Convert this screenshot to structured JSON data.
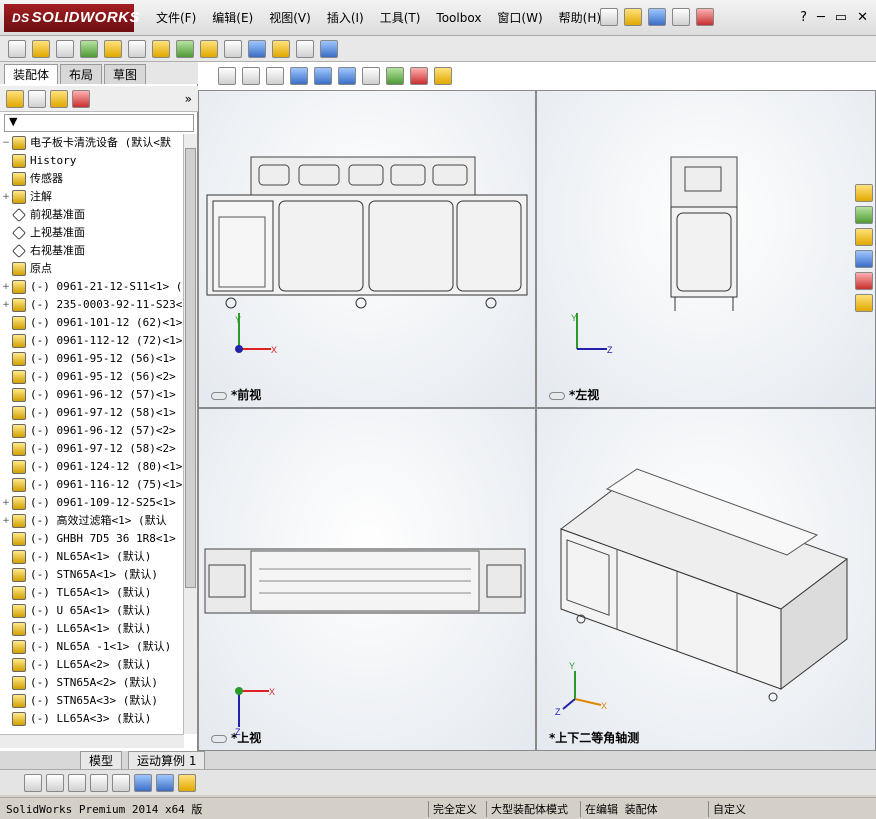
{
  "app": {
    "title": "SOLIDWORKS",
    "logo_prefix": "DS"
  },
  "menu": [
    "文件(F)",
    "编辑(E)",
    "视图(V)",
    "插入(I)",
    "工具(T)",
    "Toolbox",
    "窗口(W)",
    "帮助(H)"
  ],
  "panel": {
    "tabs": [
      "装配体",
      "布局",
      "草图"
    ],
    "root": "电子板卡清洗设备 (默认<默",
    "tree": [
      {
        "label": "History",
        "icon": "history-icon",
        "exp": ""
      },
      {
        "label": "传感器",
        "icon": "sensor-icon",
        "exp": ""
      },
      {
        "label": "注解",
        "icon": "annotation-icon",
        "exp": "+"
      },
      {
        "label": "前视基准面",
        "icon": "plane-icon",
        "exp": ""
      },
      {
        "label": "上视基准面",
        "icon": "plane-icon",
        "exp": ""
      },
      {
        "label": "右视基准面",
        "icon": "plane-icon",
        "exp": ""
      },
      {
        "label": "原点",
        "icon": "origin-icon",
        "exp": ""
      },
      {
        "label": "(-) 0961-21-12-S11<1> (",
        "icon": "part-icon",
        "exp": "+"
      },
      {
        "label": "(-) 235-0003-92-11-S23<",
        "icon": "part-icon",
        "exp": "+"
      },
      {
        "label": "(-) 0961-101-12 (62)<1>",
        "icon": "part-icon",
        "exp": ""
      },
      {
        "label": "(-) 0961-112-12 (72)<1>",
        "icon": "part-icon",
        "exp": ""
      },
      {
        "label": "(-) 0961-95-12 (56)<1>",
        "icon": "part-icon",
        "exp": ""
      },
      {
        "label": "(-) 0961-95-12 (56)<2>",
        "icon": "part-icon",
        "exp": ""
      },
      {
        "label": "(-) 0961-96-12 (57)<1>",
        "icon": "part-icon",
        "exp": ""
      },
      {
        "label": "(-) 0961-97-12 (58)<1>",
        "icon": "part-icon",
        "exp": ""
      },
      {
        "label": "(-) 0961-96-12 (57)<2>",
        "icon": "part-icon",
        "exp": ""
      },
      {
        "label": "(-) 0961-97-12 (58)<2>",
        "icon": "part-icon",
        "exp": ""
      },
      {
        "label": "(-) 0961-124-12 (80)<1>",
        "icon": "part-icon",
        "exp": ""
      },
      {
        "label": "(-) 0961-116-12 (75)<1>",
        "icon": "part-icon",
        "exp": ""
      },
      {
        "label": "(-) 0961-109-12-S25<1>",
        "icon": "part-icon",
        "exp": "+"
      },
      {
        "label": "(-) 高效过滤箱<1> (默认",
        "icon": "part-icon",
        "exp": "+"
      },
      {
        "label": "(-) GHBH 7D5 36 1R8<1>",
        "icon": "part-icon",
        "exp": ""
      },
      {
        "label": "(-) NL65A<1> (默认)",
        "icon": "part-icon",
        "exp": ""
      },
      {
        "label": "(-) STN65A<1> (默认)",
        "icon": "part-icon",
        "exp": ""
      },
      {
        "label": "(-) TL65A<1> (默认)",
        "icon": "part-icon",
        "exp": ""
      },
      {
        "label": "(-) U 65A<1> (默认)",
        "icon": "part-icon",
        "exp": ""
      },
      {
        "label": "(-) LL65A<1> (默认)",
        "icon": "part-icon",
        "exp": ""
      },
      {
        "label": "(-) NL65A -1<1> (默认)",
        "icon": "part-icon",
        "exp": ""
      },
      {
        "label": "(-) LL65A<2> (默认)",
        "icon": "part-icon",
        "exp": ""
      },
      {
        "label": "(-) STN65A<2> (默认)",
        "icon": "part-icon",
        "exp": ""
      },
      {
        "label": "(-) STN65A<3> (默认)",
        "icon": "part-icon",
        "exp": ""
      },
      {
        "label": "(-) LL65A<3> (默认)",
        "icon": "part-icon",
        "exp": ""
      }
    ]
  },
  "views": {
    "front": "*前视",
    "left": "*左视",
    "top": "*上视",
    "iso": "*上下二等角轴测"
  },
  "bottom_tabs": [
    "模型",
    "运动算例 1"
  ],
  "status": {
    "left": "SolidWorks Premium 2014 x64 版",
    "s1": "完全定义",
    "s2": "大型装配体模式",
    "s3": "在编辑 装配体",
    "s4": "自定义"
  }
}
